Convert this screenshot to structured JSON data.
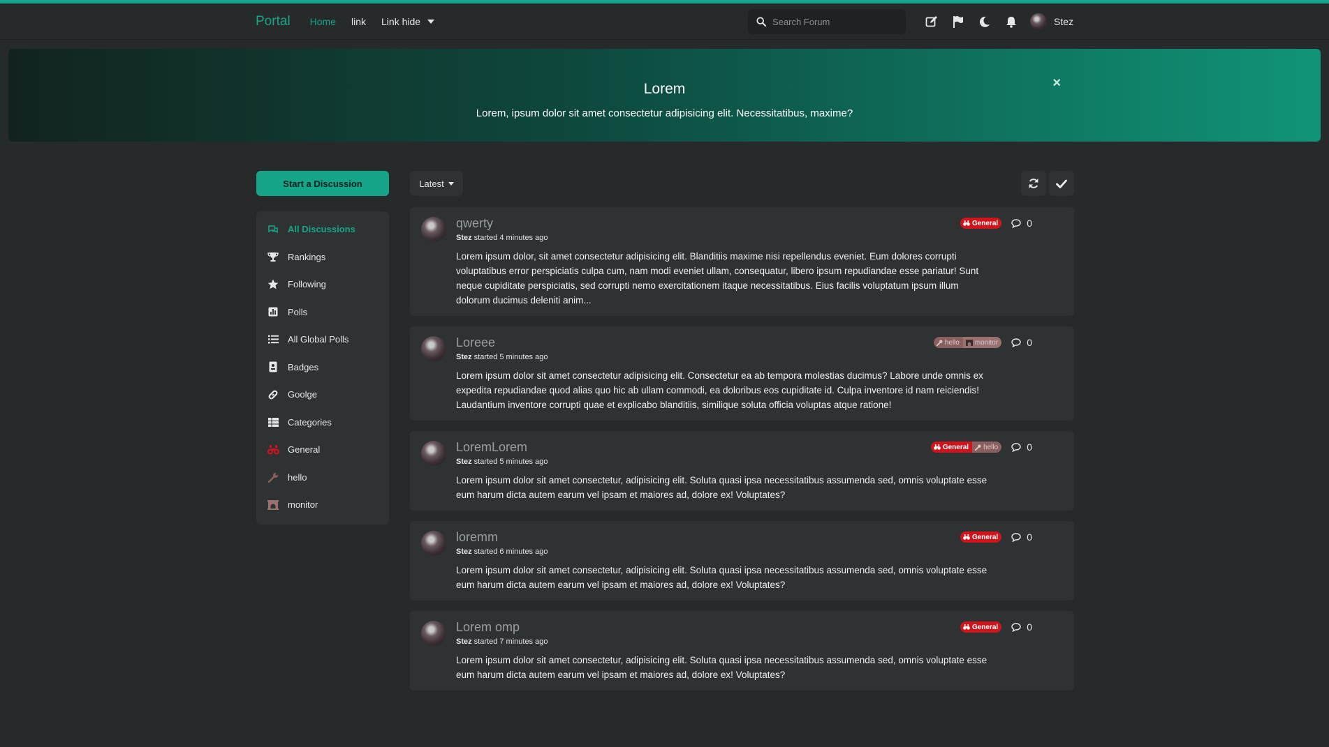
{
  "header": {
    "brand": "Portal",
    "nav": [
      {
        "label": "Home",
        "active": true
      },
      {
        "label": "link"
      },
      {
        "label": "Link hide"
      }
    ],
    "search_placeholder": "Search Forum",
    "icons": [
      "compose-icon",
      "flag-icon",
      "moon-icon",
      "bell-icon"
    ],
    "username": "Stez"
  },
  "hero": {
    "title": "Lorem",
    "text": "Lorem, ipsum dolor sit amet consectetur adipisicing elit. Necessitatibus, maxime?",
    "close": "×"
  },
  "sidebar": {
    "start_label": "Start a Discussion",
    "items": [
      {
        "label": "All Discussions",
        "icon": "comments-icon",
        "active": true
      },
      {
        "label": "Rankings",
        "icon": "trophy-icon"
      },
      {
        "label": "Following",
        "icon": "star-icon"
      },
      {
        "label": "Polls",
        "icon": "poll-icon"
      },
      {
        "label": "All Global Polls",
        "icon": "list-icon"
      },
      {
        "label": "Badges",
        "icon": "badge-icon"
      },
      {
        "label": "Goolge",
        "icon": "link-icon"
      },
      {
        "label": "Categories",
        "icon": "grid-icon"
      },
      {
        "label": "General",
        "icon": "binoculars-icon"
      },
      {
        "label": "hello",
        "icon": "wrench-icon"
      },
      {
        "label": "monitor",
        "icon": "archway-icon"
      }
    ]
  },
  "toolbar": {
    "sort_label": "Latest"
  },
  "discussions": [
    {
      "title": "qwerty",
      "author": "Stez",
      "meta": " started 4 minutes ago",
      "body": "Lorem ipsum dolor, sit amet consectetur adipisicing elit. Blanditiis maxime nisi repellendus eveniet. Eum dolores corrupti voluptatibus error perspiciatis culpa cum, nam modi eveniet ullam, consequatur, libero ipsum repudiandae esse pariatur! Sunt neque cupiditate perspiciatis, sed corrupti nemo exercitationem itaque necessitatibus. Eius facilis voluptatum ipsum illum dolorum ducimus deleniti anim...",
      "tags": [
        "General"
      ],
      "replies": "0"
    },
    {
      "title": "Loreee",
      "author": "Stez",
      "meta": " started 5 minutes ago",
      "body": "Lorem ipsum dolor sit amet consectetur adipisicing elit. Consectetur ea ab tempora molestias ducimus? Labore unde omnis ex expedita repudiandae quod alias quo hic ab ullam commodi, ea doloribus eos cupiditate id. Culpa inventore id nam reiciendis! Laudantium inventore corrupti quae et explicabo blanditiis, similique soluta officia voluptas atque ratione!",
      "tags": [
        "hello",
        "monitor"
      ],
      "replies": "0"
    },
    {
      "title": "LoremLorem",
      "author": "Stez",
      "meta": " started 5 minutes ago",
      "body": "Lorem ipsum dolor sit amet consectetur, adipisicing elit. Soluta quasi ipsa necessitatibus assumenda sed, omnis voluptate esse eum harum dicta autem earum vel ipsam et maiores ad, dolore ex! Voluptates?",
      "tags": [
        "General",
        "hello"
      ],
      "replies": "0"
    },
    {
      "title": "loremm",
      "author": "Stez",
      "meta": " started 6 minutes ago",
      "body": "Lorem ipsum dolor sit amet consectetur, adipisicing elit. Soluta quasi ipsa necessitatibus assumenda sed, omnis voluptate esse eum harum dicta autem earum vel ipsam et maiores ad, dolore ex! Voluptates?",
      "tags": [
        "General"
      ],
      "replies": "0"
    },
    {
      "title": "Lorem omp",
      "author": "Stez",
      "meta": " started 7 minutes ago",
      "body": "Lorem ipsum dolor sit amet consectetur, adipisicing elit. Soluta quasi ipsa necessitatibus assumenda sed, omnis voluptate esse eum harum dicta autem earum vel ipsam et maiores ad, dolore ex! Voluptates?",
      "tags": [
        "General"
      ],
      "replies": "0"
    }
  ],
  "colors": {
    "accent": "#17a589",
    "general_tag": "#d0141c",
    "background": "#272a2b",
    "card": "#2e3233"
  }
}
